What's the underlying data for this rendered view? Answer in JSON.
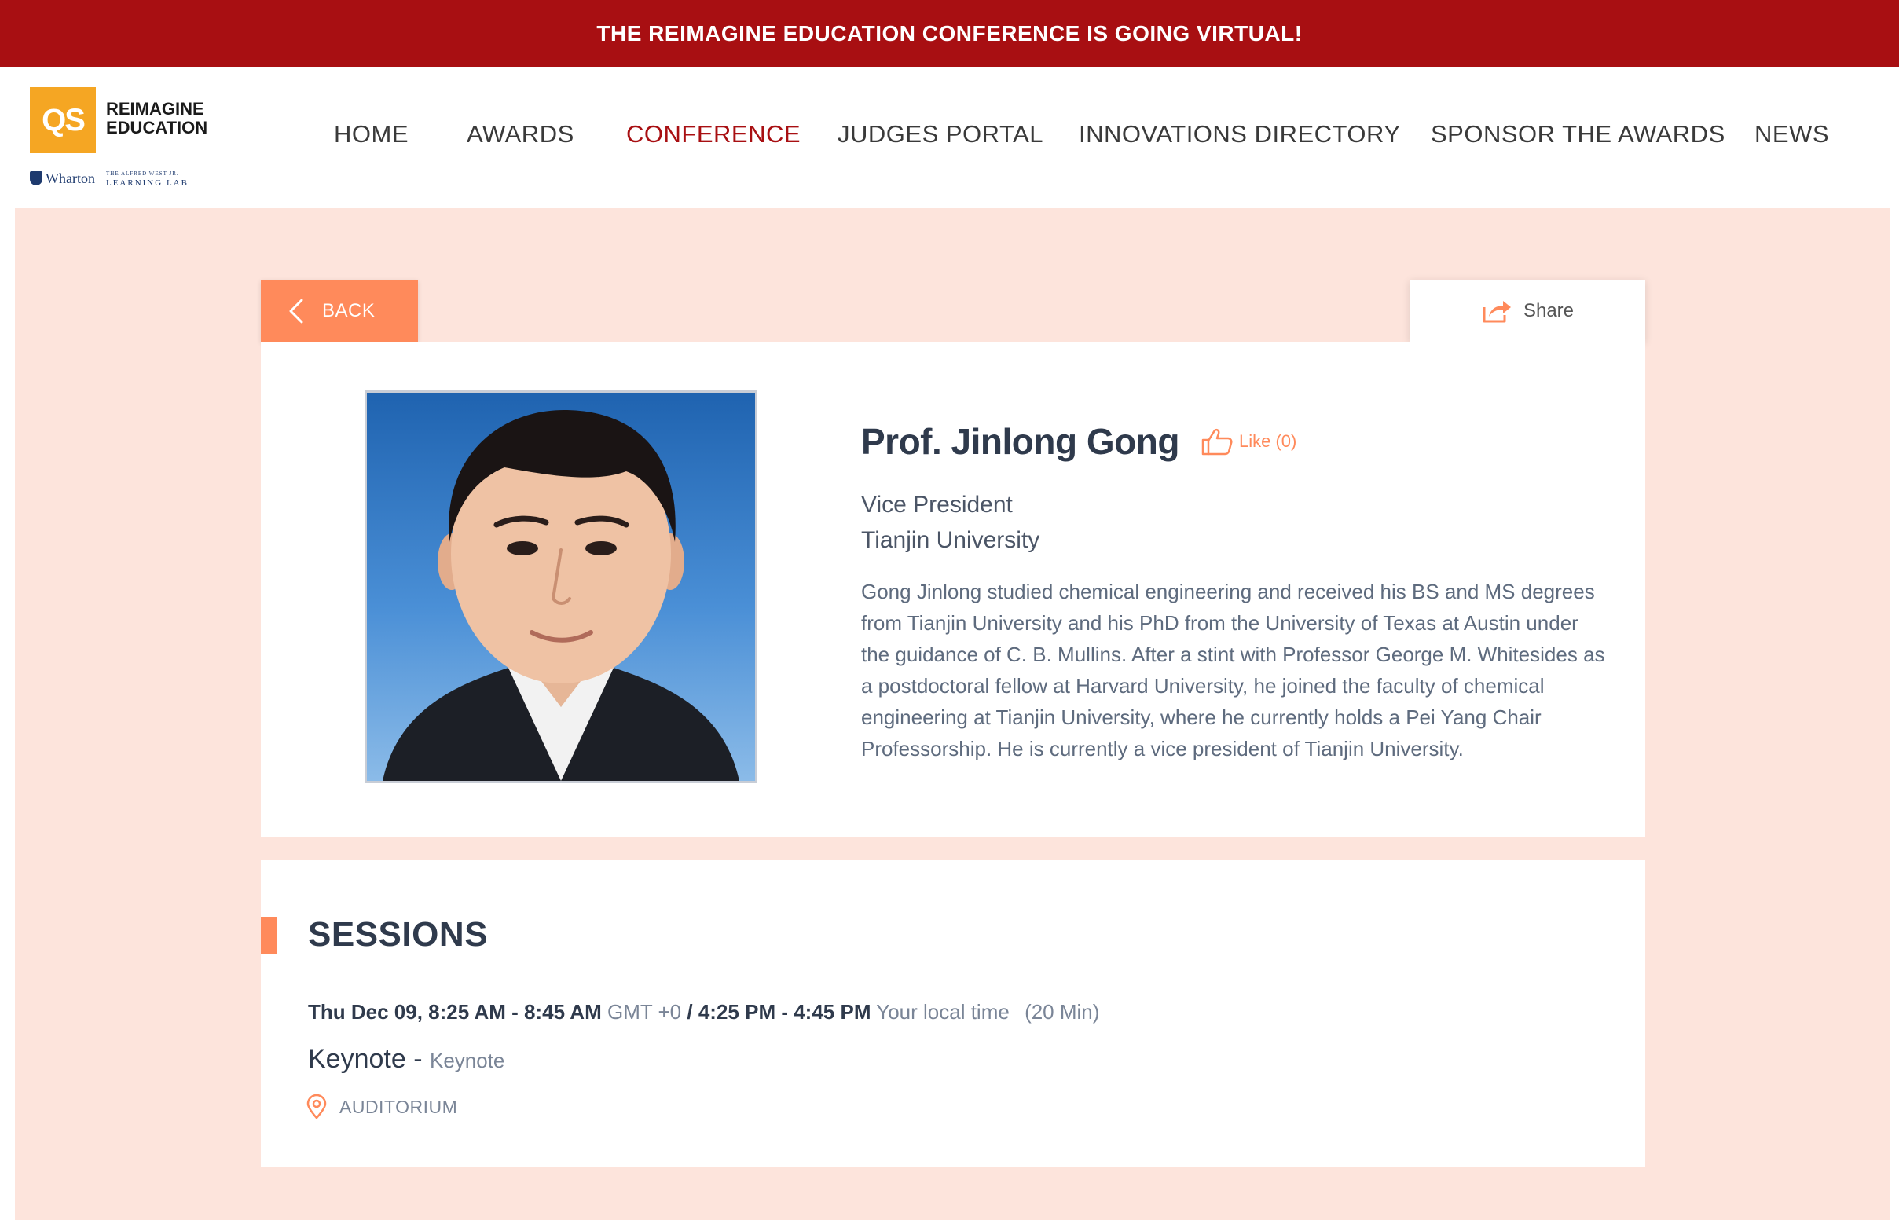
{
  "banner": {
    "text": "THE REIMAGINE EDUCATION CONFERENCE IS GOING VIRTUAL!"
  },
  "logo": {
    "mark": "QS",
    "line1": "REIMAGINE",
    "line2": "EDUCATION",
    "partner": "Wharton",
    "lab_small": "THE ALFRED WEST JR.",
    "lab": "LEARNING LAB"
  },
  "nav": {
    "items": [
      {
        "label": "HOME"
      },
      {
        "label": "AWARDS"
      },
      {
        "label": "CONFERENCE",
        "active": true
      },
      {
        "label": "JUDGES PORTAL"
      },
      {
        "label": "INNOVATIONS DIRECTORY"
      },
      {
        "label": "SPONSOR THE AWARDS"
      },
      {
        "label": "NEWS"
      }
    ]
  },
  "actions": {
    "back_label": "BACK",
    "share_label": "Share"
  },
  "speaker": {
    "name": "Prof. Jinlong Gong",
    "like_label": "Like (0)",
    "title": "Vice President",
    "organization": "Tianjin University",
    "bio": "Gong Jinlong studied chemical engineering and received his BS and MS degrees from Tianjin University and his PhD from the University of Texas at Austin under the guidance of C. B. Mullins. After a stint with Professor George M. Whitesides as a postdoctoral fellow at Harvard University, he joined the faculty of chemical engineering at Tianjin University, where he currently holds a Pei Yang Chair Professorship. He is currently a vice president of Tianjin University."
  },
  "sessions": {
    "title": "SESSIONS",
    "items": [
      {
        "gmt_time": "Thu Dec 09, 8:25 AM - 8:45 AM",
        "gmt_label": "GMT +0",
        "separator": "/",
        "local_time": "4:25 PM - 4:45 PM",
        "local_label": "Your local time",
        "duration": "(20 Min)",
        "name": "Keynote -",
        "type": "Keynote",
        "location": "AUDITORIUM"
      }
    ]
  },
  "colors": {
    "banner": "#a80f12",
    "accent": "#ff8a5b",
    "page_bg": "#fde4dc",
    "nav_active": "#a80f12",
    "qs_yellow": "#f5a623"
  }
}
